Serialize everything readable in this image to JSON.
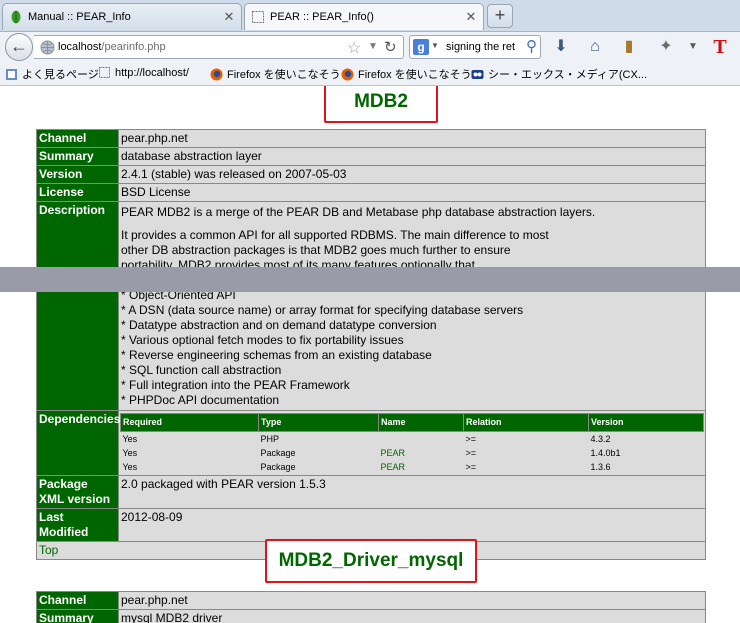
{
  "tabs": [
    {
      "title": "Manual :: PEAR_Info",
      "active": false
    },
    {
      "title": "PEAR :: PEAR_Info()",
      "active": true
    }
  ],
  "nav": {
    "url_host": "localhost",
    "url_path": "/pearinfo.php",
    "search_text": "signing the ret"
  },
  "bookmarks": [
    "よく見るページ",
    "http://localhost/",
    "Firefox を使いこなそう",
    "Firefox を使いこなそう",
    "シー・エックス・メディア(CX..."
  ],
  "packages": [
    {
      "name": "MDB2",
      "channel": "pear.php.net",
      "summary": "database abstraction layer",
      "version": "2.4.1 (stable) was released on 2007-05-03",
      "license": "BSD License",
      "description_lines": [
        "PEAR MDB2 is a merge of the PEAR DB and Metabase php database abstraction layers.",
        "",
        "It provides a common API for all supported RDBMS. The main difference to most",
        "other DB abstraction packages is that MDB2 goes much further to ensure",
        "portability. MDB2 provides most of its many features optionally that",
        "",
        "* Object-Oriented API",
        "* A DSN (data source name) or array format for specifying database servers",
        "* Datatype abstraction and on demand datatype conversion",
        "* Various optional fetch modes to fix portability issues",
        "* Reverse engineering schemas from an existing database",
        "* SQL function call abstraction",
        "* Full integration into the PEAR Framework",
        "* PHPDoc API documentation"
      ],
      "dependencies": {
        "headers": [
          "Required",
          "Type",
          "Name",
          "Relation",
          "Version"
        ],
        "rows": [
          [
            "Yes",
            "PHP",
            "",
            ">=",
            "4.3.2"
          ],
          [
            "Yes",
            "Package",
            "PEAR",
            ">=",
            "1.4.0b1"
          ],
          [
            "Yes",
            "Package",
            "PEAR",
            ">=",
            "1.3.6"
          ]
        ]
      },
      "package_xml": "2.0 packaged with PEAR version 1.5.3",
      "last_modified": "2012-08-09",
      "top_link": "Top"
    },
    {
      "name": "MDB2_Driver_mysql",
      "channel": "pear.php.net",
      "summary": "mysql MDB2 driver"
    }
  ],
  "labels": {
    "channel": "Channel",
    "summary": "Summary",
    "version": "Version",
    "license": "License",
    "description": "Description",
    "dependencies": "Dependencies",
    "package_xml": "Package XML version",
    "last_modified": "Last Modified"
  },
  "colors": {
    "key_bg": "#006600",
    "value_bg": "#dcdcdc",
    "heading_text": "#006600",
    "highlight_border": "#e0121b"
  }
}
